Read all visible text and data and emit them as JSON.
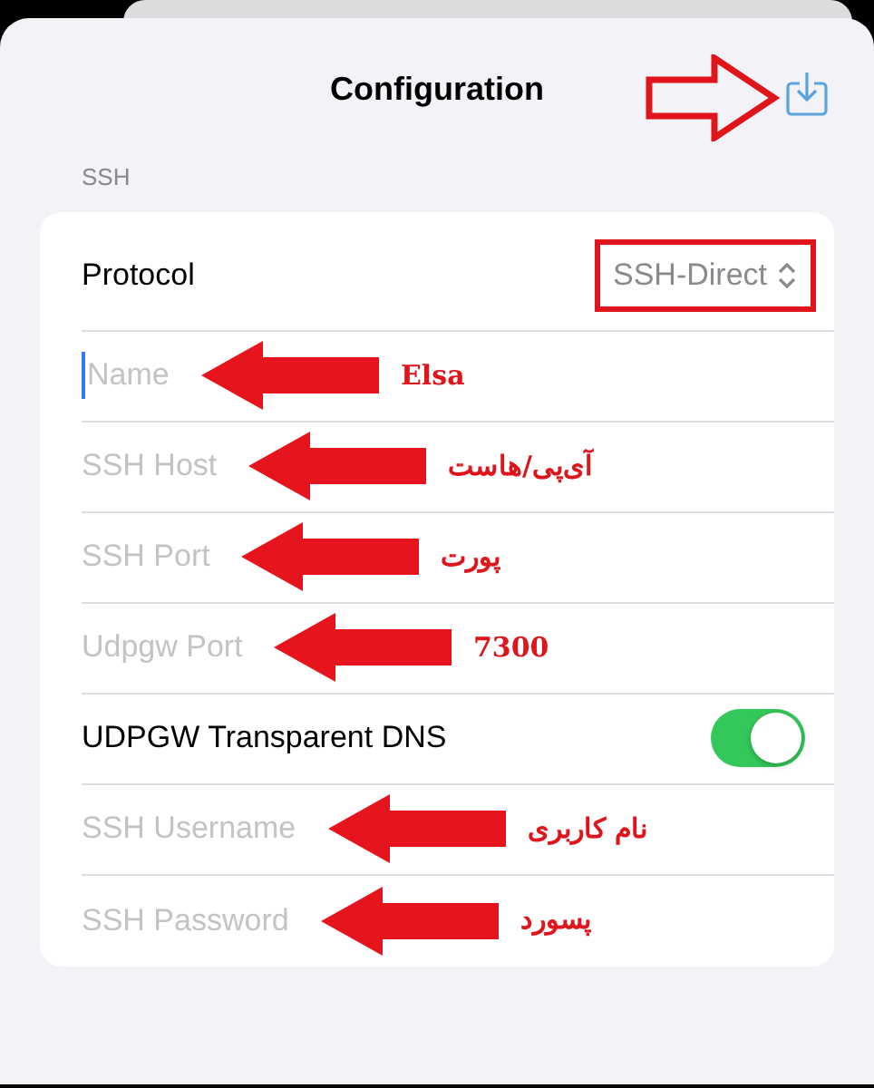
{
  "header": {
    "title": "Configuration"
  },
  "section": {
    "label": "SSH"
  },
  "rows": [
    {
      "kind": "picker",
      "label": "Protocol",
      "value": "SSH-Direct",
      "highlighted": true
    },
    {
      "kind": "text",
      "placeholder": "Name",
      "focused": true,
      "annotation": "Elsa"
    },
    {
      "kind": "text",
      "placeholder": "SSH Host",
      "focused": false,
      "annotation": "آی‌پی/هاست"
    },
    {
      "kind": "text",
      "placeholder": "SSH Port",
      "focused": false,
      "annotation": "پورت"
    },
    {
      "kind": "text",
      "placeholder": "Udpgw Port",
      "focused": false,
      "annotation": "7300"
    },
    {
      "kind": "toggle",
      "label": "UDPGW Transparent DNS",
      "on": true
    },
    {
      "kind": "text",
      "placeholder": "SSH Username",
      "focused": false,
      "annotation": "نام کاربری"
    },
    {
      "kind": "text",
      "placeholder": "SSH Password",
      "focused": false,
      "annotation": "پسورد"
    }
  ]
}
